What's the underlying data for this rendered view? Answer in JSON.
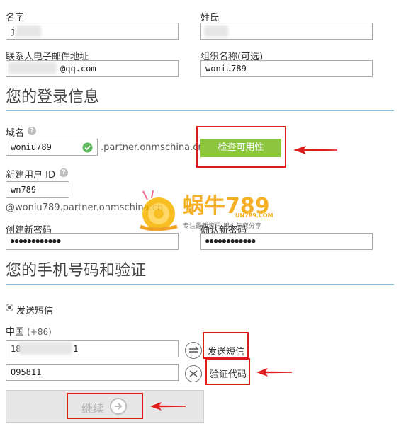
{
  "profile": {
    "first_name_label": "名字",
    "first_name_value": "j",
    "last_name_label": "姓氏",
    "email_label": "联系人电子邮件地址",
    "email_value": "@qq.com",
    "org_label": "组织名称(可选)",
    "org_value": "woniu789"
  },
  "login": {
    "section_title": "您的登录信息",
    "domain_label": "域名",
    "domain_value": "woniu789",
    "domain_suffix": ".partner.onmschina.cn",
    "check_button": "检查可用性",
    "new_user_id_label": "新建用户 ID",
    "user_id_value": "wn789",
    "user_id_suffix": "@woniu789.partner.onmschina.cn",
    "create_password_label": "创建新密码",
    "confirm_password_label": "确认新密码",
    "password_value": "●●●●●●●●●●●●",
    "confirm_value": "●●●●●●●●●●●●"
  },
  "phone": {
    "section_title": "您的手机号码和验证",
    "send_sms_option": "发送短信",
    "country": "中国",
    "country_code": "(+86)",
    "phone_start": "18",
    "phone_end": "1",
    "send_sms_link": "发送短信",
    "code_value": "095811",
    "verify_link": "验证代码"
  },
  "continue_label": "继续",
  "watermark": {
    "brand": "蜗牛789",
    "url": "UN789.COM",
    "slogan": "专注最新资讯 用心与您分享"
  },
  "colors": {
    "accent_green": "#8cc63f",
    "annotation_red": "#e01b1b",
    "rule_blue": "#8fbfd6"
  }
}
